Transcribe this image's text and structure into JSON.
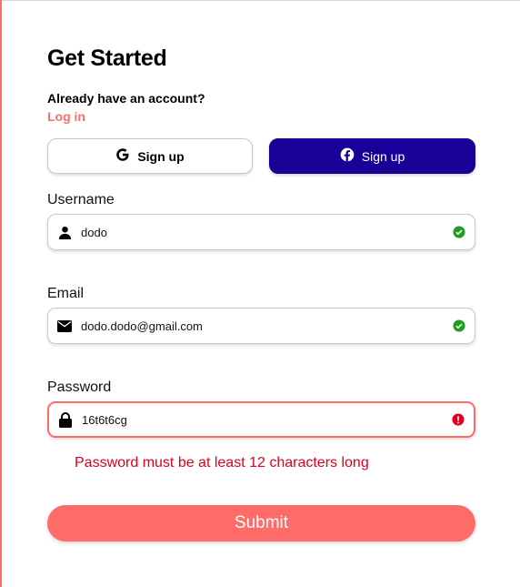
{
  "form": {
    "title": "Get Started",
    "already_text": "Already have an account?",
    "login_link": "Log in",
    "google_signup_label": "Sign up",
    "facebook_signup_label": "Sign up",
    "username": {
      "label": "Username",
      "value": "dodo",
      "status": "valid"
    },
    "email": {
      "label": "Email",
      "value": "dodo.dodo@gmail.com",
      "status": "valid"
    },
    "password": {
      "label": "Password",
      "value": "16t6t6cg",
      "status": "error",
      "error_message": "Password must be at least 12 characters long"
    },
    "submit_label": "Submit"
  },
  "icons": {
    "google": "google-icon",
    "facebook": "facebook-icon",
    "user": "user-icon",
    "email": "envelope-icon",
    "password": "lock-icon",
    "valid": "check-circle-icon",
    "error": "exclamation-circle-icon"
  },
  "colors": {
    "accent": "#ff6b66",
    "facebook_button": "#1a0096",
    "valid": "#1f9d1f",
    "error": "#e0001b"
  }
}
